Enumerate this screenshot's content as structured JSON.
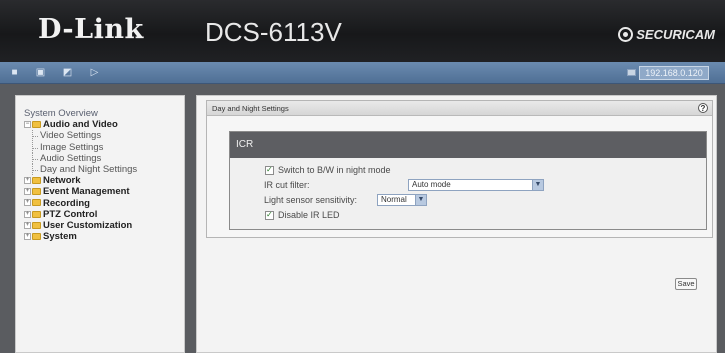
{
  "header": {
    "logo": "D-Link",
    "model": "DCS-6113V",
    "brand": "SECURICAM"
  },
  "toolbar": {
    "icons": [
      "camera-icon",
      "snapshot-icon",
      "record-icon",
      "play-icon"
    ],
    "ip_address": "192.168.0.120"
  },
  "sidebar": {
    "title": "System Overview",
    "categories": [
      {
        "label": "Audio and Video",
        "expanded": true,
        "items": [
          "Video Settings",
          "Image Settings",
          "Audio Settings",
          "Day and Night Settings"
        ]
      },
      {
        "label": "Network"
      },
      {
        "label": "Event Management"
      },
      {
        "label": "Recording"
      },
      {
        "label": "PTZ Control"
      },
      {
        "label": "User Customization"
      },
      {
        "label": "System"
      }
    ]
  },
  "panel": {
    "title": "Day and Night Settings",
    "help": "?"
  },
  "icr": {
    "heading": "ICR",
    "switch_bw_label": "Switch to B/W in night mode",
    "switch_bw_checked": true,
    "ir_cut_label": "IR cut filter:",
    "ir_cut_value": "Auto mode",
    "light_sensor_label": "Light sensor sensitivity:",
    "light_sensor_value": "Normal",
    "disable_ir_label": "Disable IR LED",
    "disable_ir_checked": true
  },
  "actions": {
    "save_label": "Save"
  },
  "colors": {
    "header_bg": "#1c1d20",
    "toolbar_bg": "#5a7aa0",
    "icr_header_bg": "#5d5e62",
    "page_bg": "#5a5c60"
  }
}
